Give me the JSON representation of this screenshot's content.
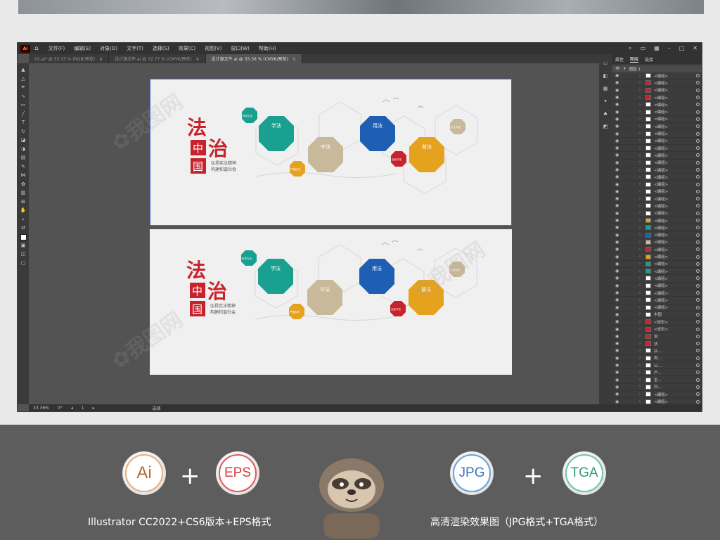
{
  "app": {
    "logo": "Ai",
    "home_icon": "home-icon",
    "menus": [
      "文件(F)",
      "编辑(E)",
      "对象(O)",
      "文字(T)",
      "选择(S)",
      "效果(C)",
      "视图(V)",
      "窗口(W)",
      "帮助(H)"
    ],
    "tabs": [
      {
        "label": "01.ai* @ 33.33 % (RGB/预览)",
        "active": false
      },
      {
        "label": "设计源文件.ai @ 72.77 % (CMYK/预览)",
        "active": false
      },
      {
        "label": "设计源文件.ai @ 33.36 % (CMYK/预览)",
        "active": true
      }
    ],
    "tab_close": "×"
  },
  "panel": {
    "tabs": [
      "属性",
      "图层",
      "链接"
    ],
    "active_tab": "图层",
    "layer_name": "图层 1",
    "rows": [
      {
        "name": "<编组>",
        "thumb": "#ffffff"
      },
      {
        "name": "<编组>",
        "thumb": "#c8232c"
      },
      {
        "name": "<编组>",
        "thumb": "#c8232c"
      },
      {
        "name": "<编组>",
        "thumb": "#c8232c"
      },
      {
        "name": "<编组>",
        "thumb": "#ffffff"
      },
      {
        "name": "<编组>",
        "thumb": "#ffffff"
      },
      {
        "name": "<编组>",
        "thumb": "#ffffff"
      },
      {
        "name": "<编组>",
        "thumb": "#ffffff"
      },
      {
        "name": "<编组>",
        "thumb": "#ffffff"
      },
      {
        "name": "<编组>",
        "thumb": "#ffffff"
      },
      {
        "name": "<编组>",
        "thumb": "#ffffff"
      },
      {
        "name": "<编组>",
        "thumb": "#ffffff"
      },
      {
        "name": "<编组>",
        "thumb": "#ffffff"
      },
      {
        "name": "<编组>",
        "thumb": "#ffffff"
      },
      {
        "name": "<编组>",
        "thumb": "#ffffff"
      },
      {
        "name": "<编组>",
        "thumb": "#ffffff"
      },
      {
        "name": "<编组>",
        "thumb": "#ffffff"
      },
      {
        "name": "<编组>",
        "thumb": "#ffffff"
      },
      {
        "name": "<编组>",
        "thumb": "#ffffff"
      },
      {
        "name": "<编组>",
        "thumb": "#ffffff"
      },
      {
        "name": "<编组>",
        "thumb": "#e5a21f"
      },
      {
        "name": "<编组>",
        "thumb": "#1aa091"
      },
      {
        "name": "<编组>",
        "thumb": "#1e5fb4"
      },
      {
        "name": "<编组>",
        "thumb": "#c8b99a"
      },
      {
        "name": "<编组>",
        "thumb": "#c8232c"
      },
      {
        "name": "<编组>",
        "thumb": "#e5a21f"
      },
      {
        "name": "<编组>",
        "thumb": "#1aa091"
      },
      {
        "name": "<编组>",
        "thumb": "#1aa091"
      },
      {
        "name": "<编组>",
        "thumb": "#ffffff"
      },
      {
        "name": "<编组>",
        "thumb": "#ffffff"
      },
      {
        "name": "<编组>",
        "thumb": "#ffffff"
      },
      {
        "name": "<编组>",
        "thumb": "#ffffff"
      },
      {
        "name": "<编组>",
        "thumb": "#ffffff"
      },
      {
        "name": "中国",
        "thumb": "#ffffff"
      },
      {
        "name": "<矩形>",
        "thumb": "#c8232c"
      },
      {
        "name": "<矩形>",
        "thumb": "#c8232c"
      },
      {
        "name": "治",
        "thumb": "#c8232c"
      },
      {
        "name": "法",
        "thumb": "#c8232c"
      },
      {
        "name": "弘...",
        "thumb": "#ffffff"
      },
      {
        "name": "构...",
        "thumb": "#ffffff"
      },
      {
        "name": "公...",
        "thumb": "#ffffff"
      },
      {
        "name": "严...",
        "thumb": "#ffffff"
      },
      {
        "name": "全...",
        "thumb": "#ffffff"
      },
      {
        "name": "科...",
        "thumb": "#ffffff"
      },
      {
        "name": "<编组>",
        "thumb": "#ffffff"
      },
      {
        "name": "<编组>",
        "thumb": "#ffffff"
      }
    ]
  },
  "status": {
    "zoom": "33.36%",
    "rotation": "0°",
    "page": "1",
    "tool": "选择"
  },
  "design": {
    "title_chars": [
      "法",
      "治",
      "中",
      "国"
    ],
    "slogan_line1": "弘扬宪法精神",
    "slogan_line2": "构建和谐社会",
    "hexes": [
      {
        "label": "学法",
        "color": "#1aa091"
      },
      {
        "label": "守法",
        "color": "#c8b99a"
      },
      {
        "label": "用法",
        "color": "#1e5fb4"
      },
      {
        "label": "普法",
        "color": "#e5a21f"
      }
    ],
    "small_hexes": [
      {
        "label": "科学立法",
        "color": "#1aa091"
      },
      {
        "label": "严格执法",
        "color": "#e5a21f"
      },
      {
        "label": "全民守法",
        "color": "#c8232c"
      },
      {
        "label": "公正司法",
        "color": "#c8b99a"
      }
    ]
  },
  "formats": {
    "ai": "Ai",
    "eps": "EPS",
    "jpg": "JPG",
    "tga": "TGA",
    "plus": "+",
    "left_caption": "Illustrator CC2022+CS6版本+EPS格式",
    "right_caption": "高清渲染效果图（JPG格式+TGA格式）"
  }
}
